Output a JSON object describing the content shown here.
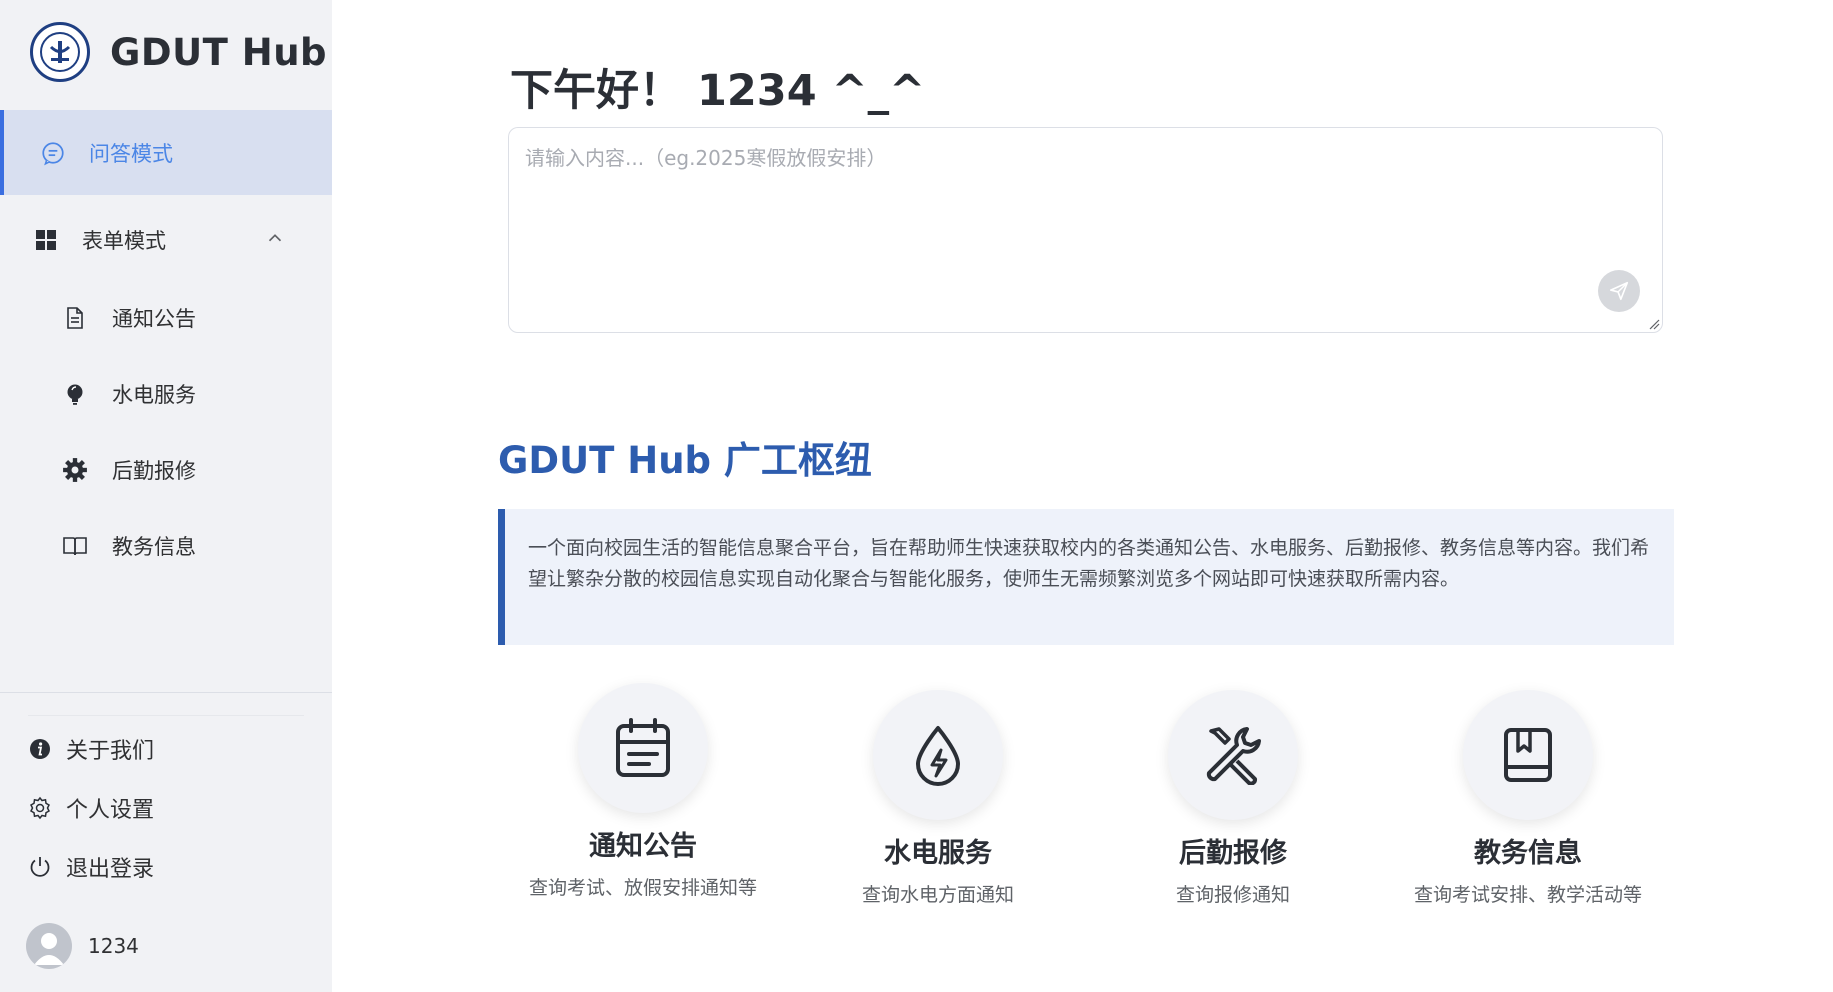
{
  "app": {
    "title": "GDUT Hub"
  },
  "sidebar": {
    "active_item": {
      "label": "问答模式",
      "icon": "chat-icon"
    },
    "group": {
      "label": "表单模式",
      "icon": "grid-icon",
      "expanded": true
    },
    "sub_items": [
      {
        "label": "通知公告",
        "icon": "document-icon"
      },
      {
        "label": "水电服务",
        "icon": "lightbulb-icon"
      },
      {
        "label": "后勤报修",
        "icon": "gear-icon"
      },
      {
        "label": "教务信息",
        "icon": "book-icon"
      }
    ],
    "footer_items": [
      {
        "label": "关于我们",
        "icon": "info-icon"
      },
      {
        "label": "个人设置",
        "icon": "settings-icon"
      },
      {
        "label": "退出登录",
        "icon": "power-icon"
      }
    ],
    "user": {
      "name": "1234"
    }
  },
  "main": {
    "greeting": "下午好！  1234 ^_^",
    "ask": {
      "placeholder": "请输入内容...（eg.2025寒假放假安排）",
      "value": ""
    },
    "hub_title": "GDUT Hub 广工枢纽",
    "intro": "一个面向校园生活的智能信息聚合平台，旨在帮助师生快速获取校内的各类通知公告、水电服务、后勤报修、教务信息等内容。我们希望让繁杂分散的校园信息实现自动化聚合与智能化服务，使师生无需频繁浏览多个网站即可快速获取所需内容。",
    "cards": [
      {
        "title": "通知公告",
        "desc": "查询考试、放假安排通知等",
        "icon": "calendar-icon"
      },
      {
        "title": "水电服务",
        "desc": "查询水电方面通知",
        "icon": "water-drop-icon"
      },
      {
        "title": "后勤报修",
        "desc": "查询报修通知",
        "icon": "tools-icon"
      },
      {
        "title": "教务信息",
        "desc": "查询考试安排、教学活动等",
        "icon": "book-icon"
      }
    ]
  },
  "colors": {
    "accent": "#2d5cae",
    "active_bg": "#d8dff0",
    "active_text": "#4b86e6",
    "sidebar_bg": "#f1f2f5"
  }
}
